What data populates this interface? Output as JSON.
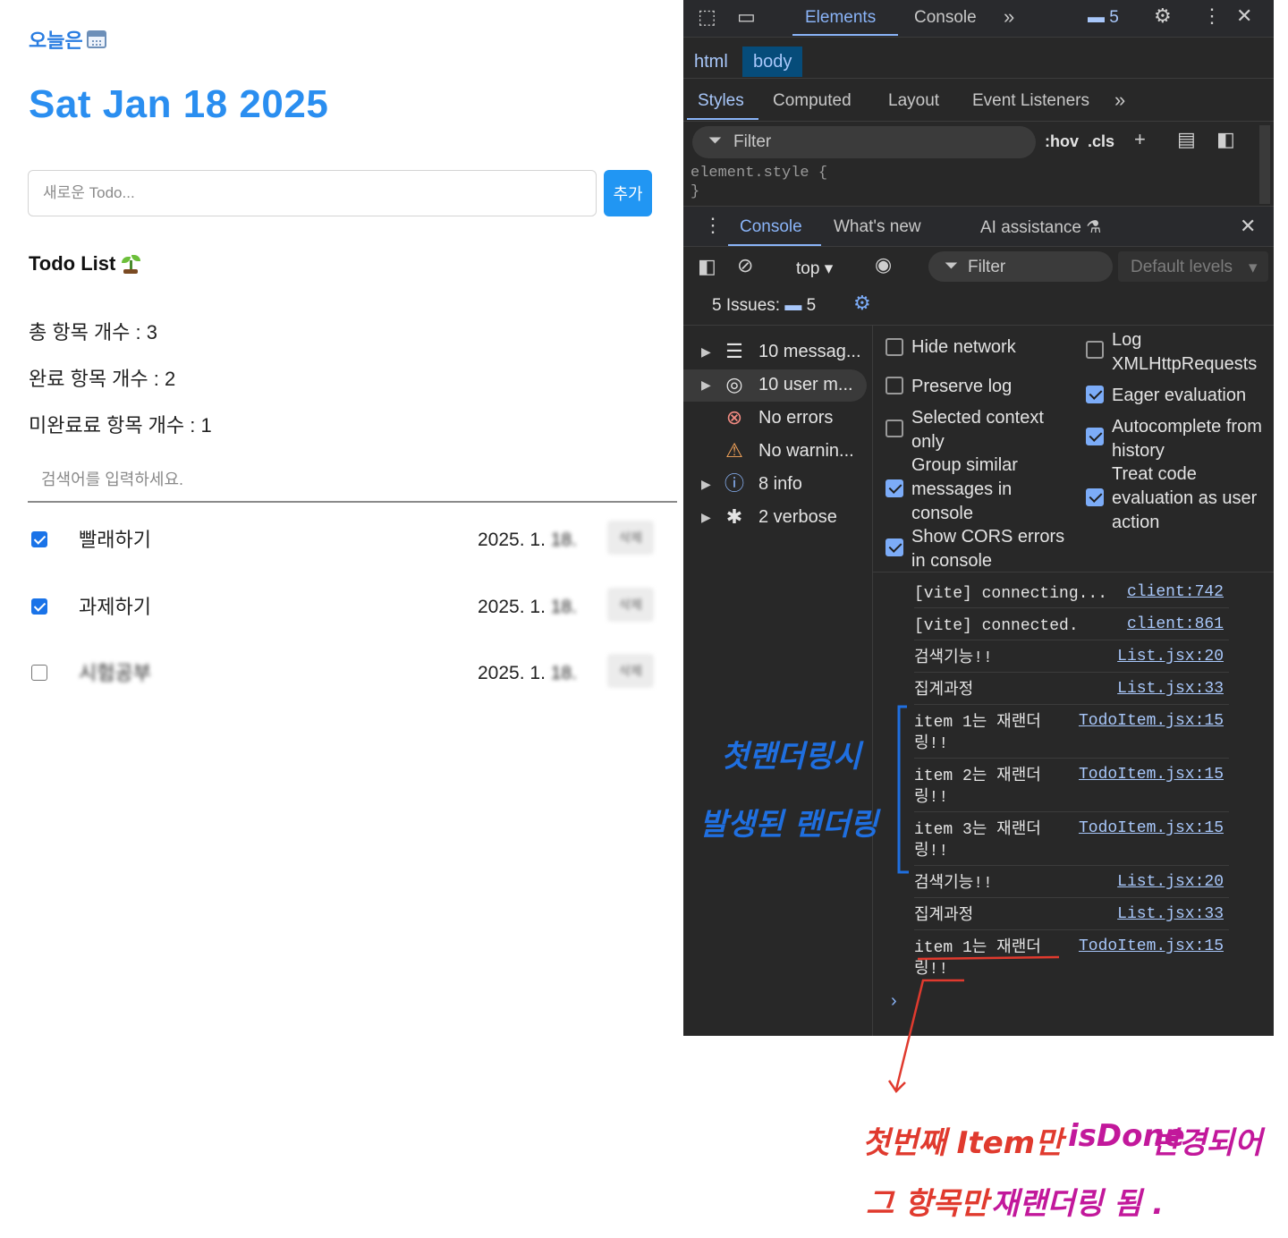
{
  "app": {
    "today_label": "오늘은",
    "date": "Sat Jan 18 2025",
    "new_todo_placeholder": "새로운 Todo...",
    "add_button": "추가",
    "list_title": "Todo List",
    "stats": {
      "total": "총 항목 개수 : 3",
      "done": "완료 항목 개수 : 2",
      "not_done": "미완료료 항목 개수 : 1"
    },
    "search_placeholder": "검색어를 입력하세요.",
    "todos": [
      {
        "content": "빨래하기",
        "done": true,
        "date_prefix": "2025. 1. ",
        "date_rest": "18.",
        "delete_label": "삭제"
      },
      {
        "content": "과제하기",
        "done": true,
        "date_prefix": "2025. 1. ",
        "date_rest": "18.",
        "delete_label": "삭제"
      },
      {
        "content": "시험공부",
        "done": false,
        "date_prefix": "2025. 1. ",
        "date_rest": "18.",
        "delete_label": "삭제"
      }
    ]
  },
  "devtools": {
    "tabs": {
      "elements": "Elements",
      "console": "Console",
      "more": "»",
      "issues_count": "5"
    },
    "breadcrumbs": [
      "html",
      "body"
    ],
    "styles_tabs": [
      "Styles",
      "Computed",
      "Layout",
      "Event Listeners",
      "»"
    ],
    "styles_filter_placeholder": "Filter",
    "hov": ":hov",
    "cls": ".cls",
    "element_style_open": "element.style {",
    "element_style_close": "}",
    "drawer_tabs": [
      "Console",
      "What's new",
      "AI assistance"
    ],
    "context": "top",
    "console_filter": "Filter",
    "levels": "Default levels",
    "issues_label": "5 Issues:",
    "issues_count": "5",
    "sidebar": [
      {
        "label": "10 messag...",
        "icon": "list-icon",
        "expandable": true
      },
      {
        "label": "10 user m...",
        "icon": "user-icon",
        "expandable": true
      },
      {
        "label": "No errors",
        "icon": "error-icon",
        "expandable": false
      },
      {
        "label": "No warnin...",
        "icon": "warning-icon",
        "expandable": false
      },
      {
        "label": "8 info",
        "icon": "info-icon",
        "expandable": true
      },
      {
        "label": "2 verbose",
        "icon": "bug-icon",
        "expandable": true
      }
    ],
    "settings": {
      "hide_network": "Hide network",
      "preserve_log": "Preserve log",
      "selected_context": "Selected context only",
      "group_similar": "Group similar messages in console",
      "show_cors": "Show CORS errors in console",
      "log_xhr": "Log XMLHttpRequests",
      "eager_eval": "Eager evaluation",
      "autocomplete": "Autocomplete from history",
      "treat_code": "Treat code evaluation as user action"
    },
    "logs": [
      {
        "msg": "[vite] connecting...",
        "src": "client:742"
      },
      {
        "msg": "[vite] connected.",
        "src": "client:861"
      },
      {
        "msg": "검색기능!!",
        "src": "List.jsx:20"
      },
      {
        "msg": "집계과정",
        "src": "List.jsx:33"
      },
      {
        "msg": "item 1는 재랜더\n링!!",
        "src": "TodoItem.jsx:15"
      },
      {
        "msg": "item 2는 재랜더\n링!!",
        "src": "TodoItem.jsx:15"
      },
      {
        "msg": "item 3는 재랜더\n링!!",
        "src": "TodoItem.jsx:15"
      },
      {
        "msg": "검색기능!!",
        "src": "List.jsx:20"
      },
      {
        "msg": "집계과정",
        "src": "List.jsx:33"
      },
      {
        "msg": "item 1는 재랜더\n링!!",
        "src": "TodoItem.jsx:15"
      }
    ],
    "prompt": "›"
  },
  "annotations": {
    "blue_line1": "첫랜더링시",
    "blue_line2": "발생된 랜더링",
    "red_line1_a": "첫번째 Item만",
    "red_line1_b": "isDone",
    "red_line1_c": "변경되어",
    "red_line2_a": "그 항목만",
    "red_line2_b": "재랜더링 됨 .",
    "colors": {
      "blue": "#1f6fe0",
      "red": "#e03a2e",
      "magenta": "#c2189b"
    }
  }
}
